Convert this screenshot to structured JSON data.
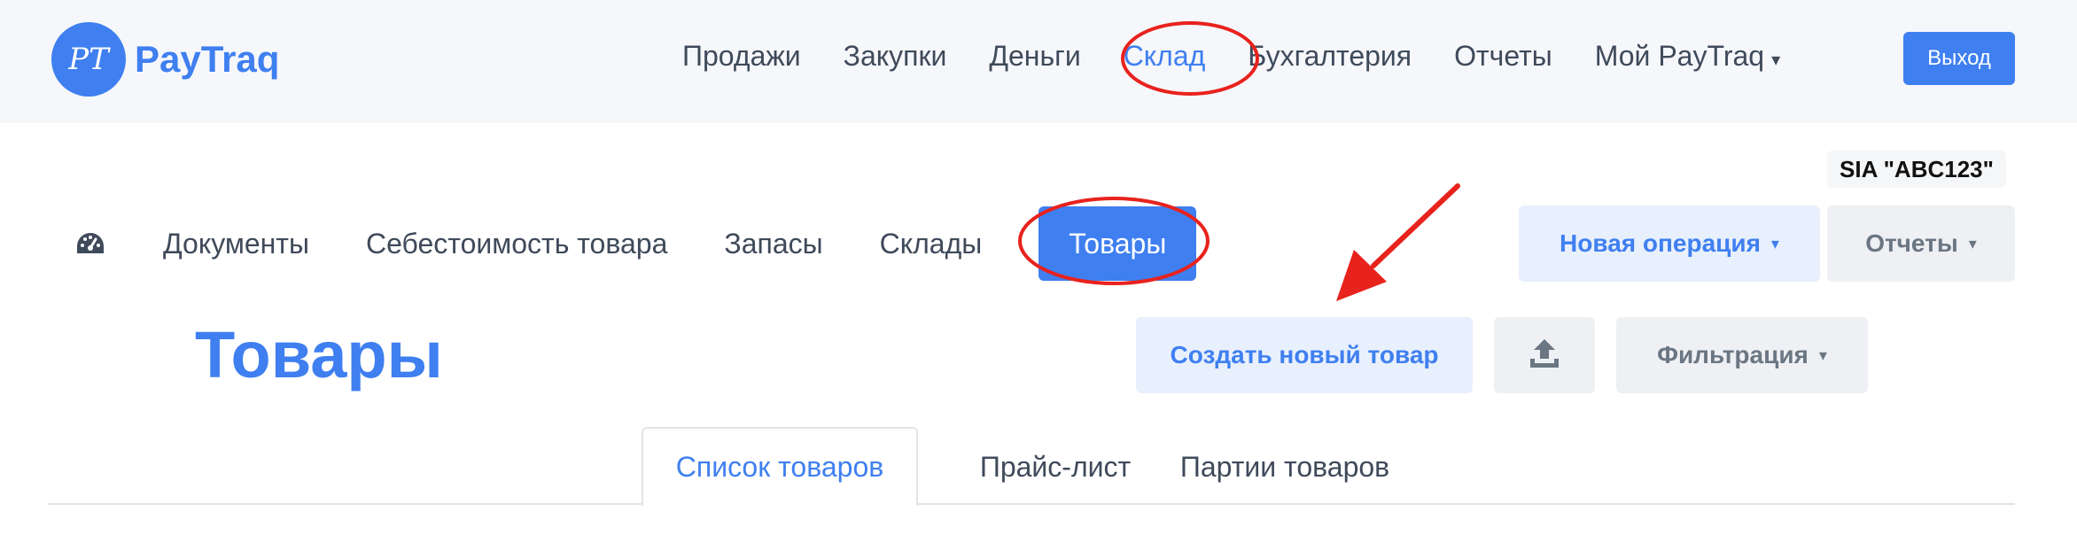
{
  "brand": {
    "logo_mark": "PT",
    "name": "PayTraq",
    "color": "#3f7ff0"
  },
  "main_nav": {
    "items": [
      {
        "label": "Продажи"
      },
      {
        "label": "Закупки"
      },
      {
        "label": "Деньги"
      },
      {
        "label": "Склад",
        "active": true
      },
      {
        "label": "Бухгалтерия"
      },
      {
        "label": "Отчеты"
      },
      {
        "label": "Мой PayTraq",
        "dropdown": true
      }
    ],
    "logout_label": "Выход"
  },
  "company": "SIA \"ABC123\"",
  "sub_nav": {
    "items": [
      {
        "label": "Документы"
      },
      {
        "label": "Себестоимость товара"
      },
      {
        "label": "Запасы"
      },
      {
        "label": "Склады"
      },
      {
        "label": "Товары",
        "active": true
      }
    ],
    "new_operation_label": "Новая операция",
    "reports_label": "Отчеты"
  },
  "page": {
    "title": "Товары",
    "create_label": "Создать новый товар",
    "filter_label": "Фильтрация"
  },
  "tabs": [
    {
      "label": "Список товаров",
      "active": true
    },
    {
      "label": "Прайс-лист"
    },
    {
      "label": "Партии товаров"
    }
  ],
  "icons": {
    "gauge": "dashboard-gauge-icon",
    "upload": "upload-icon",
    "chevron": "chevron-down-icon"
  },
  "colors": {
    "accent": "#3f7ff0",
    "annotation": "#e8221d",
    "topbar_bg": "#f6f7fb"
  }
}
